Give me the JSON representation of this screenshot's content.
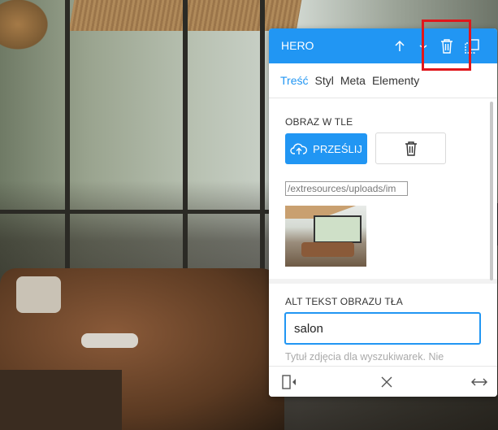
{
  "panel": {
    "title": "HERO",
    "header_icons": [
      "arrow-up-icon",
      "chevron-down-icon",
      "trash-icon",
      "copy-icon"
    ],
    "tabs": [
      {
        "label": "Treść",
        "active": true
      },
      {
        "label": "Styl",
        "active": false
      },
      {
        "label": "Meta",
        "active": false
      },
      {
        "label": "Elementy",
        "active": false
      }
    ],
    "background_image": {
      "label": "OBRAZ W TLE",
      "upload_label": "PRZEŚLIJ",
      "path_value": "/extresources/uploads/im"
    },
    "alt_text": {
      "label": "ALT TEKST OBRAZU TŁA",
      "value": "salon",
      "hint": "Tytuł zdjęcia dla wyszukiwarek. Nie"
    },
    "footer_icons": [
      "dock-left-icon",
      "close-icon",
      "expand-horizontal-icon"
    ]
  },
  "colors": {
    "accent": "#2196f3",
    "highlight": "#e0161b"
  }
}
